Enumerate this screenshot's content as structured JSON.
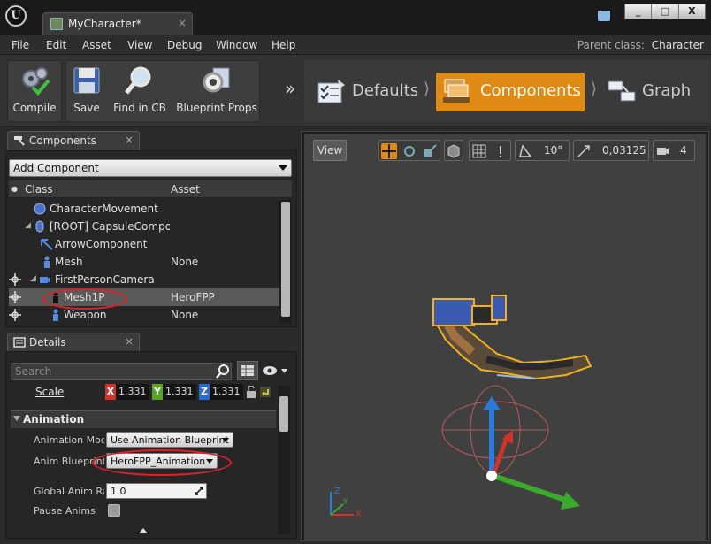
{
  "window": {
    "tab_title": "MyCharacter*",
    "tab_close": "×",
    "controls": [
      "_",
      "□",
      "X"
    ]
  },
  "menu": {
    "items": [
      "File",
      "Edit",
      "Asset",
      "View",
      "Debug",
      "Window",
      "Help"
    ],
    "parent_class_label": "Parent class:",
    "parent_class_value": "Character"
  },
  "toolbar": {
    "buttons": [
      {
        "label": "Compile",
        "icon": "compile-gears-check-icon"
      },
      {
        "label": "Save",
        "icon": "save-disk-icon"
      },
      {
        "label": "Find in CB",
        "icon": "magnifier-icon"
      },
      {
        "label": "Blueprint Props",
        "icon": "blueprint-props-gear-icon"
      }
    ]
  },
  "modes": {
    "lead": "»",
    "separator": "⟩",
    "items": [
      {
        "label": "Defaults",
        "icon": "checklist-icon",
        "active": false
      },
      {
        "label": "Components",
        "icon": "components-icon",
        "active": true
      },
      {
        "label": "Graph",
        "icon": "graph-icon",
        "active": false
      }
    ]
  },
  "components_panel": {
    "tab_label": "Components",
    "tab_close": "×",
    "add_component_label": "Add Component",
    "columns": [
      "Class",
      "Asset"
    ],
    "rows": [
      {
        "label": "CharacterMovement",
        "asset": "",
        "icon": "movement-sphere-icon"
      },
      {
        "label": "[ROOT] CapsuleComponent",
        "asset": "",
        "icon": "capsule-icon"
      },
      {
        "label": "ArrowComponent",
        "asset": "",
        "icon": "arrow-icon"
      },
      {
        "label": "Mesh",
        "asset": "None",
        "icon": "skeletal-mesh-icon"
      },
      {
        "label": "FirstPersonCamera",
        "asset": "",
        "icon": "camera-icon"
      },
      {
        "label": "Mesh1P",
        "asset": "HeroFPP",
        "icon": "skeletal-mesh-icon",
        "selected": true
      },
      {
        "label": "Weapon",
        "asset": "None",
        "icon": "skeletal-mesh-icon"
      }
    ]
  },
  "details_panel": {
    "tab_label": "Details",
    "tab_close": "×",
    "search_placeholder": "Search",
    "scale": {
      "label": "Scale",
      "x": "1.331",
      "y": "1.331",
      "z": "1.331"
    },
    "section_title": "Animation",
    "animation_mode_label": "Animation Mod",
    "animation_mode_value": "Use Animation Blueprint",
    "anim_blueprint_label": "Anim Blueprint",
    "anim_blueprint_value": "HeroFPP_AnimationBl",
    "global_anim_rate_label": "Global Anim Ra",
    "global_anim_rate_value": "1.0",
    "pause_anims_label": "Pause Anims",
    "pause_anims_checked": false
  },
  "viewport": {
    "view_label": "View",
    "angle_snap": "10°",
    "scale_snap": "0,03125",
    "camera_speed": "4"
  },
  "colors": {
    "active_mode": "#e08a16",
    "annotation_red": "#e0202a",
    "axis_x": "#d0332a",
    "axis_y": "#5aa42a",
    "axis_z": "#2a6ad0"
  }
}
